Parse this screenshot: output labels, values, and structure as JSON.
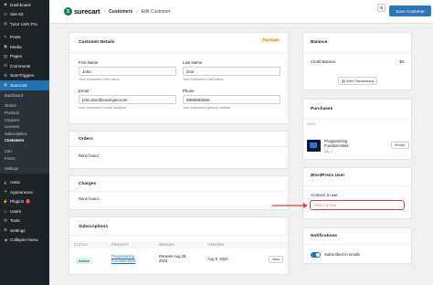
{
  "wp_sidebar": {
    "items_top": [
      {
        "icon": "dashboard-icon",
        "glyph": "◉",
        "label": "Dashboard"
      },
      {
        "icon": "sitekit-icon",
        "glyph": "G",
        "label": "Site Kit"
      },
      {
        "icon": "tutor-icon",
        "glyph": "◍",
        "label": "Tutor LMS Pro"
      }
    ],
    "items_mid": [
      {
        "icon": "posts-icon",
        "glyph": "✎",
        "label": "Posts"
      },
      {
        "icon": "media-icon",
        "glyph": "▣",
        "label": "Media"
      },
      {
        "icon": "pages-icon",
        "glyph": "▤",
        "label": "Pages"
      },
      {
        "icon": "comments-icon",
        "glyph": "✉",
        "label": "Comments"
      },
      {
        "icon": "suretriggers-icon",
        "glyph": "⚙",
        "label": "SureTriggers"
      }
    ],
    "active_item": {
      "icon": "surecart-icon",
      "glyph": "◎",
      "label": "SureCart"
    },
    "submenu_top": [
      "Dashboard"
    ],
    "submenu_main": [
      "Orders",
      "Products",
      "Coupons",
      "Licenses",
      "Subscriptions",
      "Customers"
    ],
    "submenu_current": "Customers",
    "submenu_lower": [
      "Cart",
      "Forms"
    ],
    "submenu_settings": [
      "Settings"
    ],
    "items_bottom": [
      {
        "icon": "astra-icon",
        "glyph": "◭",
        "label": "Astra"
      },
      {
        "icon": "appearance-icon",
        "glyph": "✦",
        "label": "Appearance"
      },
      {
        "icon": "plugins-icon",
        "glyph": "⚡",
        "label": "Plugins",
        "badge": "1"
      },
      {
        "icon": "users-icon",
        "glyph": "☺",
        "label": "Users"
      },
      {
        "icon": "tools-icon",
        "glyph": "⚒",
        "label": "Tools"
      },
      {
        "icon": "settings-icon",
        "glyph": "⚙",
        "label": "Settings"
      },
      {
        "icon": "collapse-icon",
        "glyph": "◀",
        "label": "Collapse menu"
      }
    ]
  },
  "header": {
    "brand": "surecart",
    "brand_mark": "S",
    "crumbs": [
      "Customers",
      "Edit Customer"
    ],
    "settings_glyph": "⚙",
    "save_label": "Save Customer"
  },
  "customer_details": {
    "title": "Customer Details",
    "mode_tag": "Test Mode",
    "first_name": {
      "label": "First Name",
      "value": "John",
      "help": "Your customer's first name."
    },
    "last_name": {
      "label": "Last Name",
      "value": "Doe",
      "help": "Your customer's last name."
    },
    "email": {
      "label": "Email",
      "required": "*",
      "value": "john.doe@example.com",
      "help": "Your customer's email address."
    },
    "phone": {
      "label": "Phone",
      "value": "5555555555",
      "help": "Your customer's phone number."
    }
  },
  "orders": {
    "title": "Orders",
    "empty": "None found."
  },
  "charges": {
    "title": "Charges",
    "empty": "None found."
  },
  "subscriptions": {
    "title": "Subscriptions",
    "columns": [
      "STATUS",
      "PRODUCT",
      "RENEWS",
      "CREATED"
    ],
    "rows": [
      {
        "status": "Active",
        "product": "Programming Fundamentals",
        "renews": "Renews Aug 28, 2024",
        "created": "Aug 9, 2023",
        "action": "View"
      }
    ]
  },
  "balance": {
    "title": "Balance",
    "label": "Credit Balance",
    "value": "$0",
    "button": "View Transactions"
  },
  "purchases": {
    "title": "Purchases",
    "column": "ITEM",
    "item_name": "Programming Fundamentals",
    "item_qty": "Qty: 1",
    "action": "Revoke"
  },
  "wp_user": {
    "title": "WordPress User",
    "label": "Connect a user",
    "placeholder": "Select a user"
  },
  "notifications": {
    "title": "Notifications",
    "toggle_label": "Subscribed to emails"
  },
  "colors": {
    "accent": "#2271b1",
    "brand_green": "#01824c",
    "highlight": "#e03a47"
  }
}
